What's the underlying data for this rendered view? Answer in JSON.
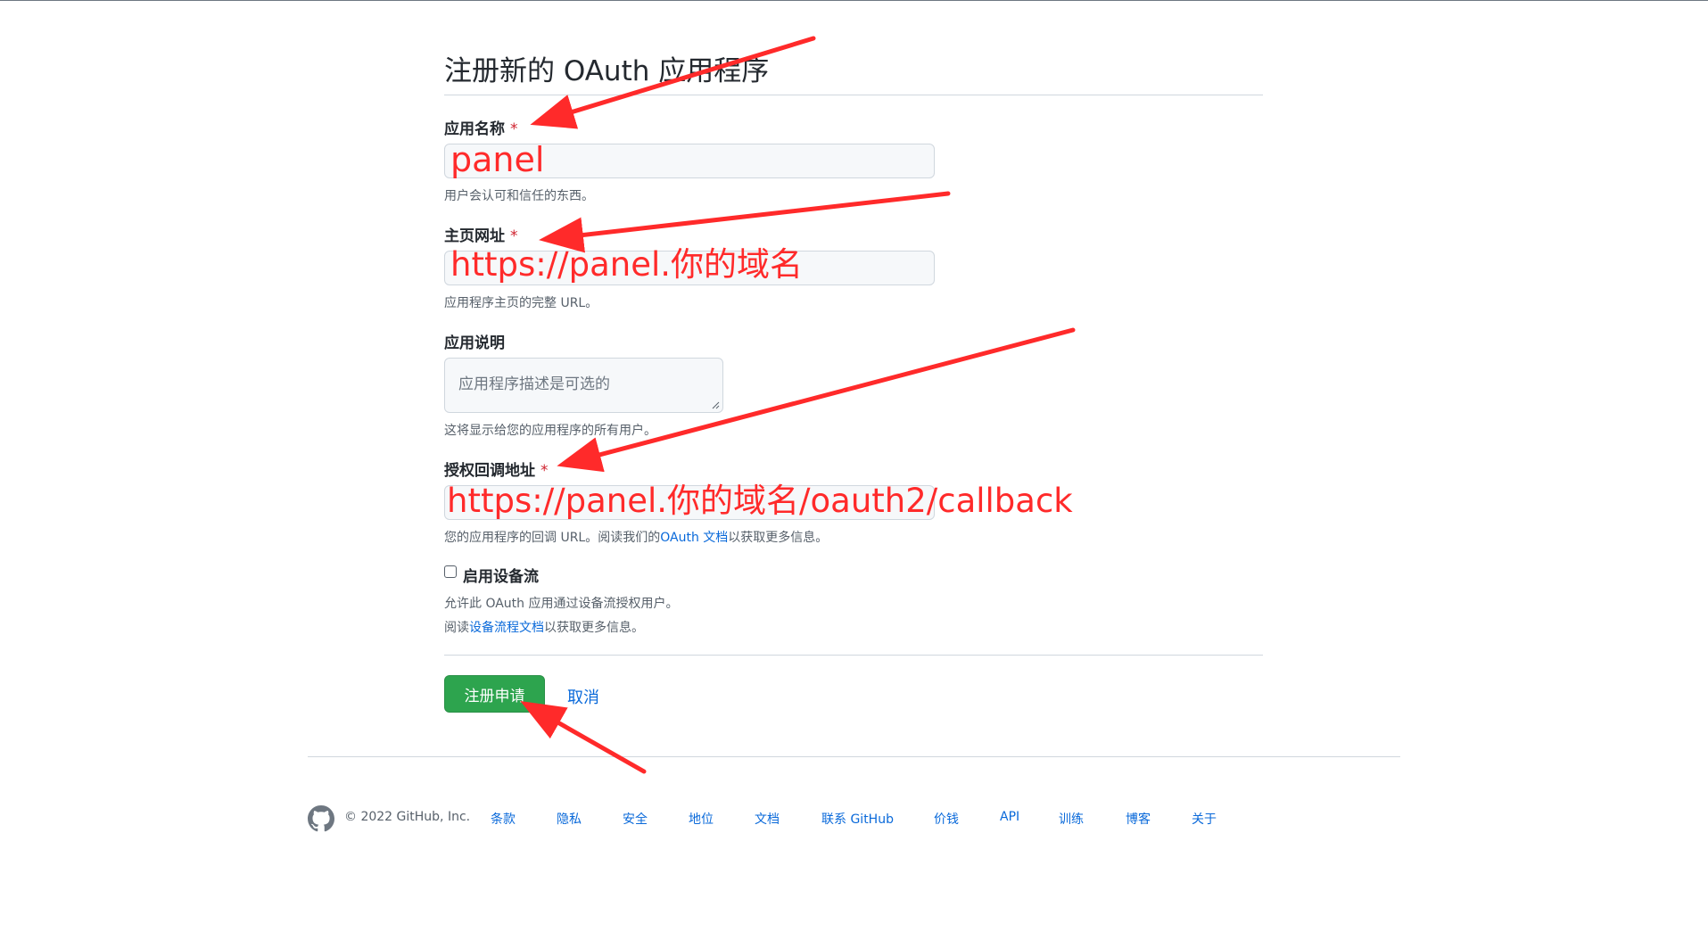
{
  "page": {
    "title": "注册新的 OAuth 应用程序"
  },
  "form": {
    "app_name": {
      "label": "应用名称",
      "required_mark": "*",
      "value": "panel",
      "help": "用户会认可和信任的东西。"
    },
    "homepage_url": {
      "label": "主页网址",
      "required_mark": "*",
      "value": "https://panel.你的域名",
      "help": "应用程序主页的完整 URL。"
    },
    "description": {
      "label": "应用说明",
      "placeholder": "应用程序描述是可选的",
      "help": "这将显示给您的应用程序的所有用户。"
    },
    "callback_url": {
      "label": "授权回调地址",
      "required_mark": "*",
      "value": "https://panel.你的域名/oauth2/callback",
      "help_prefix": "您的应用程序的回调 URL。阅读我们的",
      "help_link": "OAuth 文档",
      "help_suffix": "以获取更多信息。"
    },
    "device_flow": {
      "label": "启用设备流",
      "checked": false,
      "help_line1": "允许此 OAuth 应用通过设备流授权用户。",
      "help_line2_prefix": "阅读",
      "help_line2_link": "设备流程文档",
      "help_line2_suffix": "以获取更多信息。"
    },
    "submit_label": "注册申请",
    "cancel_label": "取消"
  },
  "footer": {
    "copyright": "© 2022 GitHub, Inc.",
    "links": [
      "条款",
      "隐私",
      "安全",
      "地位",
      "文档",
      "联系 GitHub",
      "价钱",
      "API",
      "训练",
      "博客",
      "关于"
    ]
  },
  "icons": {
    "footer_logo": "github-mark-icon",
    "resize": "resize-grip-icon"
  },
  "colors": {
    "primary_button": "#2da44e",
    "link": "#0969da",
    "annotation": "#ff2a2a",
    "required": "#cf222e"
  }
}
